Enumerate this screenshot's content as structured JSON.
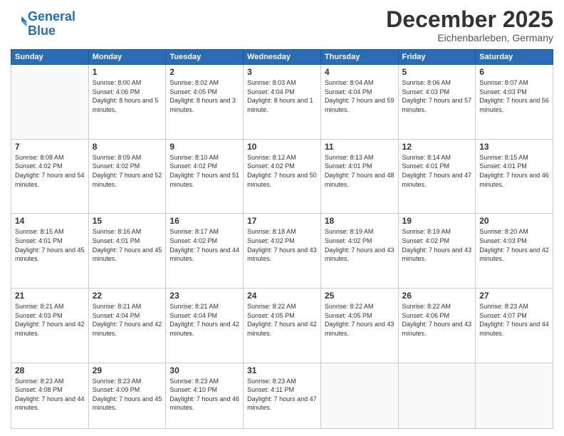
{
  "logo": {
    "line1": "General",
    "line2": "Blue"
  },
  "title": "December 2025",
  "location": "Eichenbarleben, Germany",
  "weekdays": [
    "Sunday",
    "Monday",
    "Tuesday",
    "Wednesday",
    "Thursday",
    "Friday",
    "Saturday"
  ],
  "weeks": [
    [
      {
        "day": null
      },
      {
        "day": 1,
        "sunrise": "8:00 AM",
        "sunset": "4:06 PM",
        "daylight": "8 hours and 5 minutes."
      },
      {
        "day": 2,
        "sunrise": "8:02 AM",
        "sunset": "4:05 PM",
        "daylight": "8 hours and 3 minutes."
      },
      {
        "day": 3,
        "sunrise": "8:03 AM",
        "sunset": "4:04 PM",
        "daylight": "8 hours and 1 minute."
      },
      {
        "day": 4,
        "sunrise": "8:04 AM",
        "sunset": "4:04 PM",
        "daylight": "7 hours and 59 minutes."
      },
      {
        "day": 5,
        "sunrise": "8:06 AM",
        "sunset": "4:03 PM",
        "daylight": "7 hours and 57 minutes."
      },
      {
        "day": 6,
        "sunrise": "8:07 AM",
        "sunset": "4:03 PM",
        "daylight": "7 hours and 56 minutes."
      }
    ],
    [
      {
        "day": 7,
        "sunrise": "8:08 AM",
        "sunset": "4:02 PM",
        "daylight": "7 hours and 54 minutes."
      },
      {
        "day": 8,
        "sunrise": "8:09 AM",
        "sunset": "4:02 PM",
        "daylight": "7 hours and 52 minutes."
      },
      {
        "day": 9,
        "sunrise": "8:10 AM",
        "sunset": "4:02 PM",
        "daylight": "7 hours and 51 minutes."
      },
      {
        "day": 10,
        "sunrise": "8:12 AM",
        "sunset": "4:02 PM",
        "daylight": "7 hours and 50 minutes."
      },
      {
        "day": 11,
        "sunrise": "8:13 AM",
        "sunset": "4:01 PM",
        "daylight": "7 hours and 48 minutes."
      },
      {
        "day": 12,
        "sunrise": "8:14 AM",
        "sunset": "4:01 PM",
        "daylight": "7 hours and 47 minutes."
      },
      {
        "day": 13,
        "sunrise": "8:15 AM",
        "sunset": "4:01 PM",
        "daylight": "7 hours and 46 minutes."
      }
    ],
    [
      {
        "day": 14,
        "sunrise": "8:15 AM",
        "sunset": "4:01 PM",
        "daylight": "7 hours and 45 minutes."
      },
      {
        "day": 15,
        "sunrise": "8:16 AM",
        "sunset": "4:01 PM",
        "daylight": "7 hours and 45 minutes."
      },
      {
        "day": 16,
        "sunrise": "8:17 AM",
        "sunset": "4:02 PM",
        "daylight": "7 hours and 44 minutes."
      },
      {
        "day": 17,
        "sunrise": "8:18 AM",
        "sunset": "4:02 PM",
        "daylight": "7 hours and 43 minutes."
      },
      {
        "day": 18,
        "sunrise": "8:19 AM",
        "sunset": "4:02 PM",
        "daylight": "7 hours and 43 minutes."
      },
      {
        "day": 19,
        "sunrise": "8:19 AM",
        "sunset": "4:02 PM",
        "daylight": "7 hours and 43 minutes."
      },
      {
        "day": 20,
        "sunrise": "8:20 AM",
        "sunset": "4:03 PM",
        "daylight": "7 hours and 42 minutes."
      }
    ],
    [
      {
        "day": 21,
        "sunrise": "8:21 AM",
        "sunset": "4:03 PM",
        "daylight": "7 hours and 42 minutes."
      },
      {
        "day": 22,
        "sunrise": "8:21 AM",
        "sunset": "4:04 PM",
        "daylight": "7 hours and 42 minutes."
      },
      {
        "day": 23,
        "sunrise": "8:21 AM",
        "sunset": "4:04 PM",
        "daylight": "7 hours and 42 minutes."
      },
      {
        "day": 24,
        "sunrise": "8:22 AM",
        "sunset": "4:05 PM",
        "daylight": "7 hours and 42 minutes."
      },
      {
        "day": 25,
        "sunrise": "8:22 AM",
        "sunset": "4:05 PM",
        "daylight": "7 hours and 43 minutes."
      },
      {
        "day": 26,
        "sunrise": "8:22 AM",
        "sunset": "4:06 PM",
        "daylight": "7 hours and 43 minutes."
      },
      {
        "day": 27,
        "sunrise": "8:23 AM",
        "sunset": "4:07 PM",
        "daylight": "7 hours and 44 minutes."
      }
    ],
    [
      {
        "day": 28,
        "sunrise": "8:23 AM",
        "sunset": "4:08 PM",
        "daylight": "7 hours and 44 minutes."
      },
      {
        "day": 29,
        "sunrise": "8:23 AM",
        "sunset": "4:09 PM",
        "daylight": "7 hours and 45 minutes."
      },
      {
        "day": 30,
        "sunrise": "8:23 AM",
        "sunset": "4:10 PM",
        "daylight": "7 hours and 46 minutes."
      },
      {
        "day": 31,
        "sunrise": "8:23 AM",
        "sunset": "4:11 PM",
        "daylight": "7 hours and 47 minutes."
      },
      {
        "day": null
      },
      {
        "day": null
      },
      {
        "day": null
      }
    ]
  ]
}
